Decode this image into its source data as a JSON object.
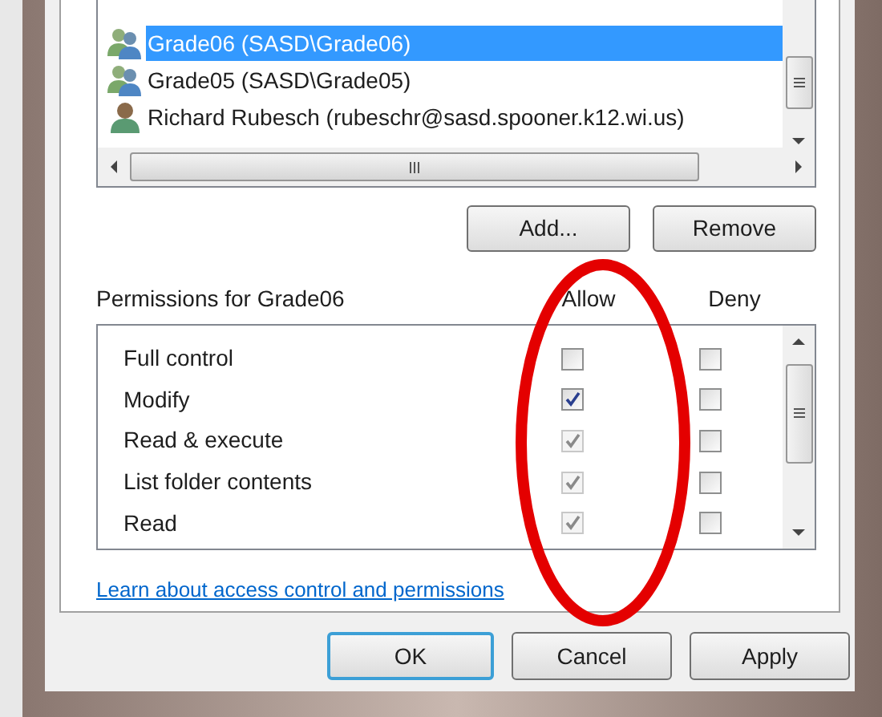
{
  "principals": [
    {
      "kind": "group",
      "name": "Grade06 (SASD\\Grade06)",
      "selected": true
    },
    {
      "kind": "group",
      "name": "Grade05 (SASD\\Grade05)",
      "selected": false
    },
    {
      "kind": "user",
      "name": "Richard Rubesch (rubeschr@sasd.spooner.k12.wi.us)",
      "selected": false
    }
  ],
  "principal_buttons": [
    "Add...",
    "Remove"
  ],
  "permissions": {
    "title": "Permissions for Grade06",
    "columns": [
      "Allow",
      "Deny"
    ],
    "rows": [
      {
        "label": "Full control",
        "allow": {
          "checked": false,
          "disabled": false
        },
        "deny": {
          "checked": false,
          "disabled": false
        }
      },
      {
        "label": "Modify",
        "allow": {
          "checked": true,
          "disabled": false
        },
        "deny": {
          "checked": false,
          "disabled": false
        }
      },
      {
        "label": "Read & execute",
        "allow": {
          "checked": true,
          "disabled": true
        },
        "deny": {
          "checked": false,
          "disabled": false
        }
      },
      {
        "label": "List folder contents",
        "allow": {
          "checked": true,
          "disabled": true
        },
        "deny": {
          "checked": false,
          "disabled": false
        }
      },
      {
        "label": "Read",
        "allow": {
          "checked": true,
          "disabled": true
        },
        "deny": {
          "checked": false,
          "disabled": false
        }
      }
    ]
  },
  "link": "Learn about access control and permissions",
  "buttons": [
    {
      "label": "OK",
      "default": true
    },
    {
      "label": "Cancel",
      "default": false
    },
    {
      "label": "Apply",
      "default": false
    }
  ]
}
